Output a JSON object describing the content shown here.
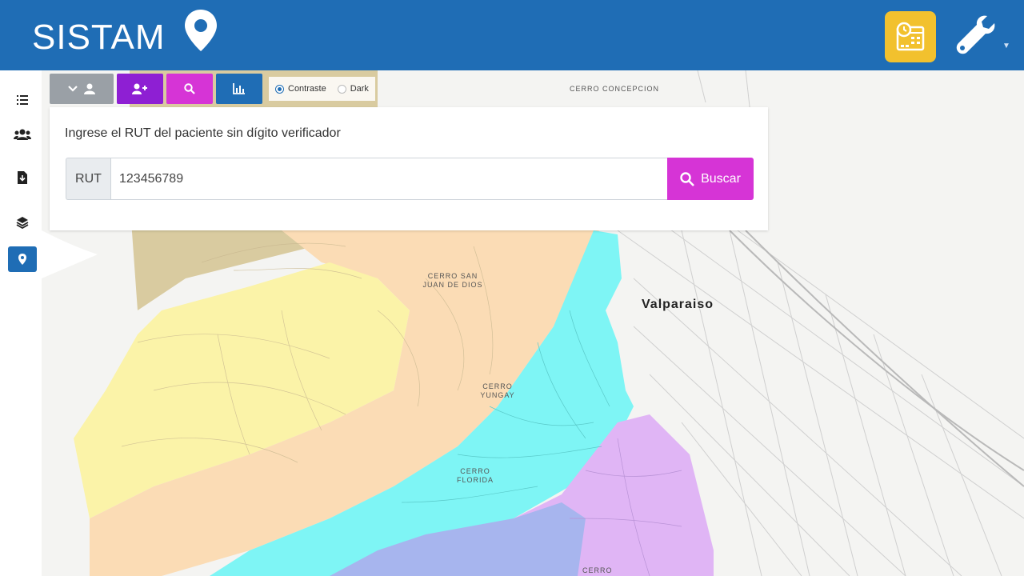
{
  "app": {
    "title": "SISTAM"
  },
  "header": {
    "calendar_icon": "calendar-clock-icon",
    "tools_icon": "wrench-icon"
  },
  "sidebar": {
    "items": [
      {
        "name": "list",
        "icon": "list-icon"
      },
      {
        "name": "patients",
        "icon": "users-icon"
      },
      {
        "name": "download",
        "icon": "file-download-icon"
      },
      {
        "name": "layers",
        "icon": "layers-icon"
      },
      {
        "name": "map",
        "icon": "map-marker-icon",
        "active": true
      }
    ]
  },
  "toolbar": {
    "radios": [
      {
        "label": "Contraste",
        "checked": true
      },
      {
        "label": "Dark",
        "checked": false
      }
    ]
  },
  "search": {
    "title": "Ingrese el RUT del paciente sin dígito verificador",
    "addon": "RUT",
    "value": "123456789",
    "button": "Buscar"
  },
  "map": {
    "city": "Valparaiso",
    "areas": [
      {
        "name": "CERRO CONCEPCION"
      },
      {
        "name": "CERRO SAN JUAN DE DIOS"
      },
      {
        "name": "CERRO YUNGAY"
      },
      {
        "name": "CERRO FLORIDA"
      },
      {
        "name": "CERRO"
      }
    ]
  },
  "colors": {
    "header": "#1f6db5",
    "accent_magenta": "#d634d6",
    "accent_purple": "#8e1fd3",
    "accent_yellow": "#f2c12e",
    "zone_yellow": "#fbf3a8",
    "zone_peach": "#fbdcb5",
    "zone_cyan": "#7ef5f5",
    "zone_violet": "#e0b5f5",
    "zone_blue": "#a7b5ee",
    "zone_olive": "#d9cba0"
  }
}
